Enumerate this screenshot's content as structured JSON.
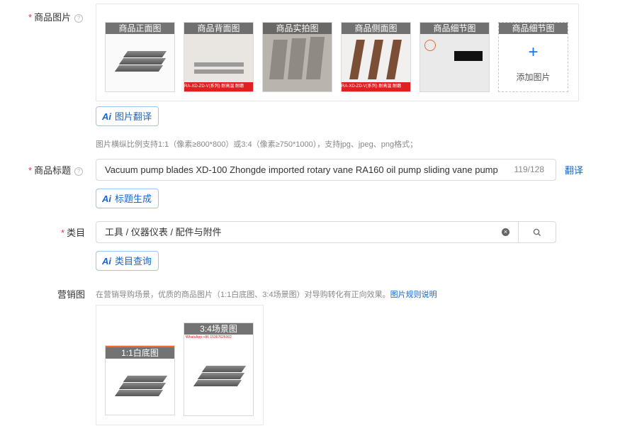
{
  "product_images": {
    "label": "商品图片",
    "slots": [
      {
        "caption": "商品正面图",
        "footer": ""
      },
      {
        "caption": "商品背面图",
        "footer": "RA-XD-ZD-V(系列)  耐高温  耐磨"
      },
      {
        "caption": "商品实拍图",
        "footer": ""
      },
      {
        "caption": "商品侧面图",
        "footer": "RA-XD-ZD-V(系列)  耐高温  耐磨"
      },
      {
        "caption": "商品细节图",
        "footer": ""
      }
    ],
    "add_caption": "商品细节图",
    "add_label": "添加图片",
    "translate_button": "图片翻译",
    "hint": "图片横纵比例支持1:1（像素≥800*800）或3:4（像素≥750*1000），支持jpg、jpeg、png格式；"
  },
  "title_field": {
    "label": "商品标题",
    "value": "Vacuum pump blades XD-100 Zhongde imported rotary vane RA160 oil pump sliding vane pump",
    "counter": "119/128",
    "translate_link": "翻译",
    "generate_button": "标题生成"
  },
  "category": {
    "label": "类目",
    "value": "工具 / 仪器仪表 / 配件与附件",
    "query_button": "类目查询"
  },
  "marketing": {
    "label": "营销图",
    "hint": "在营销导购场景，优质的商品图片（1:1白底图、3:4场景图）对导购转化有正向效果。",
    "rule_link": "图片规则说明",
    "white_caption": "1:1白底图",
    "scene_caption": "3:4场景图",
    "scene_watermark": "WhatsApp:+86 15367626002"
  },
  "ai_badge": "Ai",
  "icons": {
    "help": "help-circle-icon",
    "clear": "clear-circle-icon",
    "search": "search-icon",
    "add": "plus-icon"
  },
  "colors": {
    "accent": "#1a73e8",
    "required": "#e4393c"
  }
}
